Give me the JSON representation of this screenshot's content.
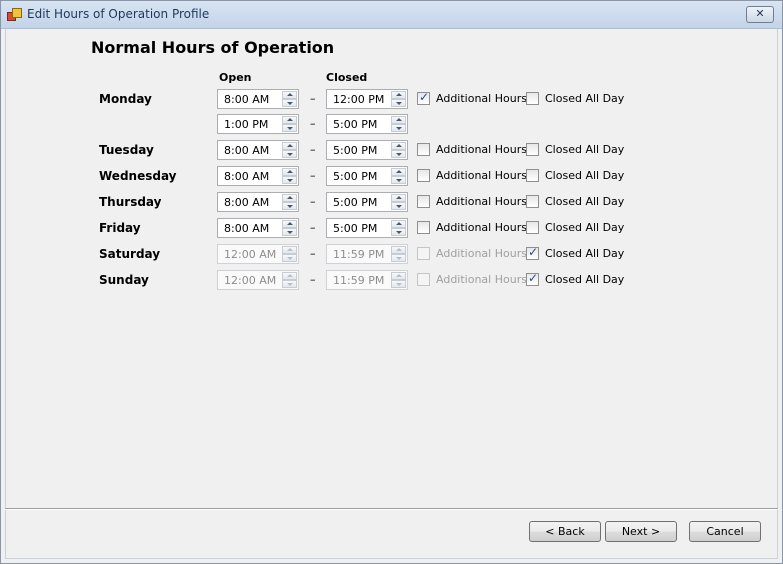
{
  "window": {
    "title": "Edit Hours of Operation Profile",
    "close_glyph": "✕"
  },
  "heading": "Normal Hours of Operation",
  "columns": {
    "open": "Open",
    "closed": "Closed"
  },
  "separator_dash": "–",
  "checkbox_labels": {
    "additional": "Additional Hours",
    "closed_all_day": "Closed All Day"
  },
  "days": [
    {
      "name": "Monday",
      "open": "8:00 AM",
      "close": "12:00 PM",
      "additional": true,
      "closed_all_day": false,
      "disabled": false,
      "extra": {
        "open": "1:00 PM",
        "close": "5:00 PM"
      }
    },
    {
      "name": "Tuesday",
      "open": "8:00 AM",
      "close": "5:00 PM",
      "additional": false,
      "closed_all_day": false,
      "disabled": false
    },
    {
      "name": "Wednesday",
      "open": "8:00 AM",
      "close": "5:00 PM",
      "additional": false,
      "closed_all_day": false,
      "disabled": false
    },
    {
      "name": "Thursday",
      "open": "8:00 AM",
      "close": "5:00 PM",
      "additional": false,
      "closed_all_day": false,
      "disabled": false
    },
    {
      "name": "Friday",
      "open": "8:00 AM",
      "close": "5:00 PM",
      "additional": false,
      "closed_all_day": false,
      "disabled": false
    },
    {
      "name": "Saturday",
      "open": "12:00 AM",
      "close": "11:59 PM",
      "additional": false,
      "closed_all_day": true,
      "disabled": true
    },
    {
      "name": "Sunday",
      "open": "12:00 AM",
      "close": "11:59 PM",
      "additional": false,
      "closed_all_day": true,
      "disabled": true
    }
  ],
  "buttons": {
    "back": "< Back",
    "next": "Next >",
    "cancel": "Cancel"
  }
}
